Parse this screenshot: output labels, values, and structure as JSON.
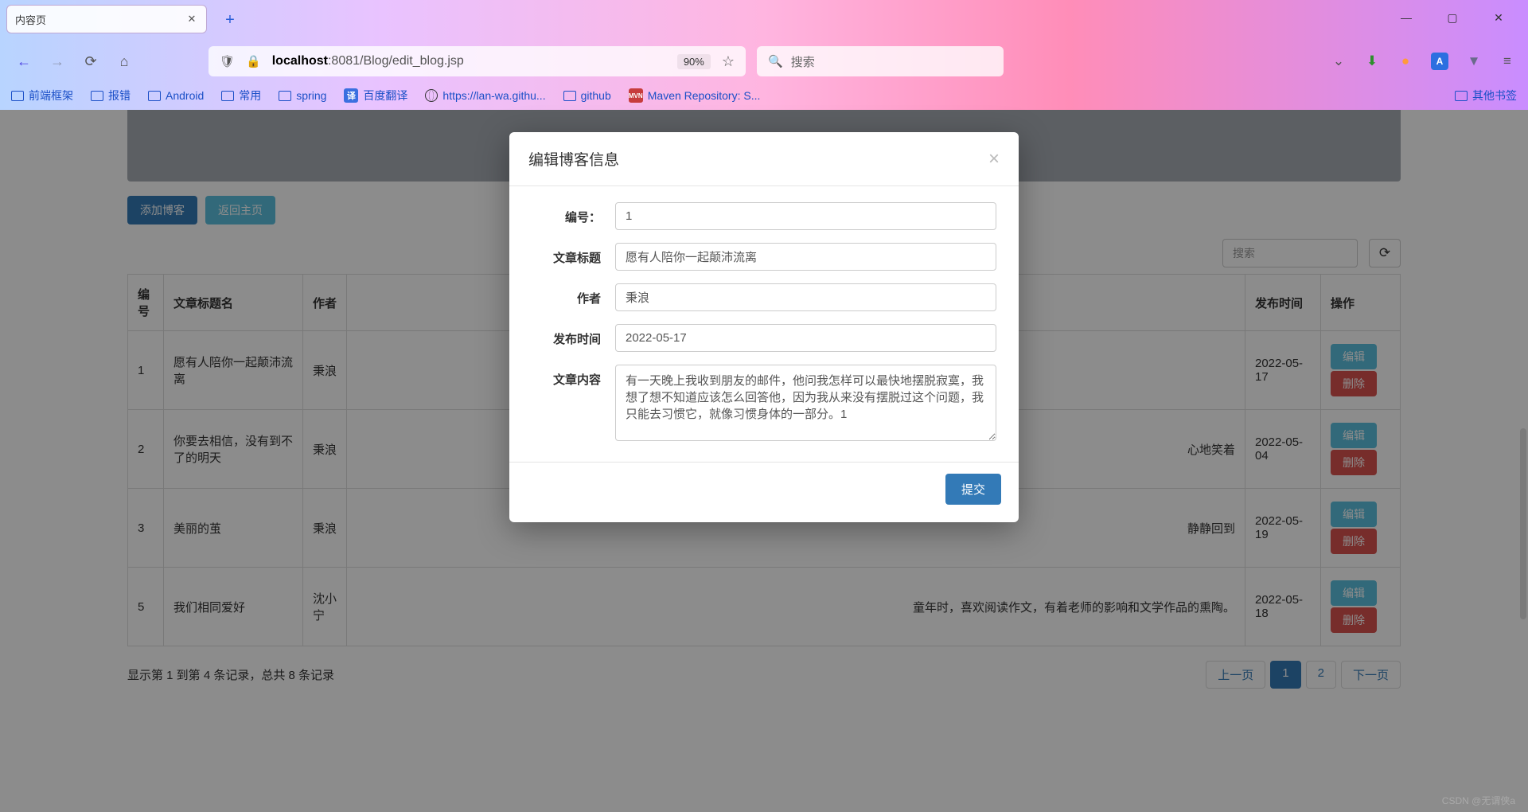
{
  "window": {
    "tab_title": "内容页",
    "minimize": "—",
    "maximize": "▢",
    "close": "✕",
    "newtab": "+"
  },
  "nav": {
    "url_host": "localhost",
    "url_rest": ":8081/Blog/edit_blog.jsp",
    "zoom": "90%",
    "search_ph": "搜索"
  },
  "bookmarks": {
    "items": [
      "前端框架",
      "报错",
      "Android",
      "常用",
      "spring",
      "百度翻译",
      "https://lan-wa.githu...",
      "github",
      "Maven Repository: S..."
    ],
    "other": "其他书签"
  },
  "page": {
    "add_btn": "添加博客",
    "back_btn": "返回主页",
    "search_ph": "搜索",
    "cols": {
      "id": "编号",
      "title": "文章标题名",
      "author": "作者",
      "date": "发布时间",
      "ops": "操作"
    },
    "edit": "编辑",
    "delete": "删除",
    "rows": [
      {
        "id": "1",
        "title": "愿有人陪你一起颠沛流离",
        "author": "秉浪",
        "content": "",
        "date": "2022-05-17"
      },
      {
        "id": "2",
        "title": "你要去相信，没有到不了的明天",
        "author": "秉浪",
        "content": "心地笑着",
        "date": "2022-05-04"
      },
      {
        "id": "3",
        "title": "美丽的茧",
        "author": "秉浪",
        "content": "静静回到",
        "date": "2022-05-19"
      },
      {
        "id": "5",
        "title": "我们相同爱好",
        "author": "沈小宁",
        "content": "童年时，喜欢阅读作文，有着老师的影响和文学作品的熏陶。",
        "date": "2022-05-18"
      }
    ],
    "footer": "显示第 1 到第 4 条记录，总共 8 条记录",
    "prev": "上一页",
    "next": "下一页",
    "pages": [
      "1",
      "2"
    ]
  },
  "modal": {
    "title": "编辑博客信息",
    "labels": {
      "id": "编号：",
      "title": "文章标题",
      "author": "作者",
      "date": "发布时间",
      "content": "文章内容"
    },
    "values": {
      "id": "1",
      "title": "愿有人陪你一起颠沛流离",
      "author": "秉浪",
      "date": "2022-05-17",
      "content": "有一天晚上我收到朋友的邮件，他问我怎样可以最快地摆脱寂寞，我想了想不知道应该怎么回答他，因为我从来没有摆脱过这个问题，我只能去习惯它，就像习惯身体的一部分。1"
    },
    "submit": "提交"
  },
  "watermark": "CSDN @无谓侠a"
}
